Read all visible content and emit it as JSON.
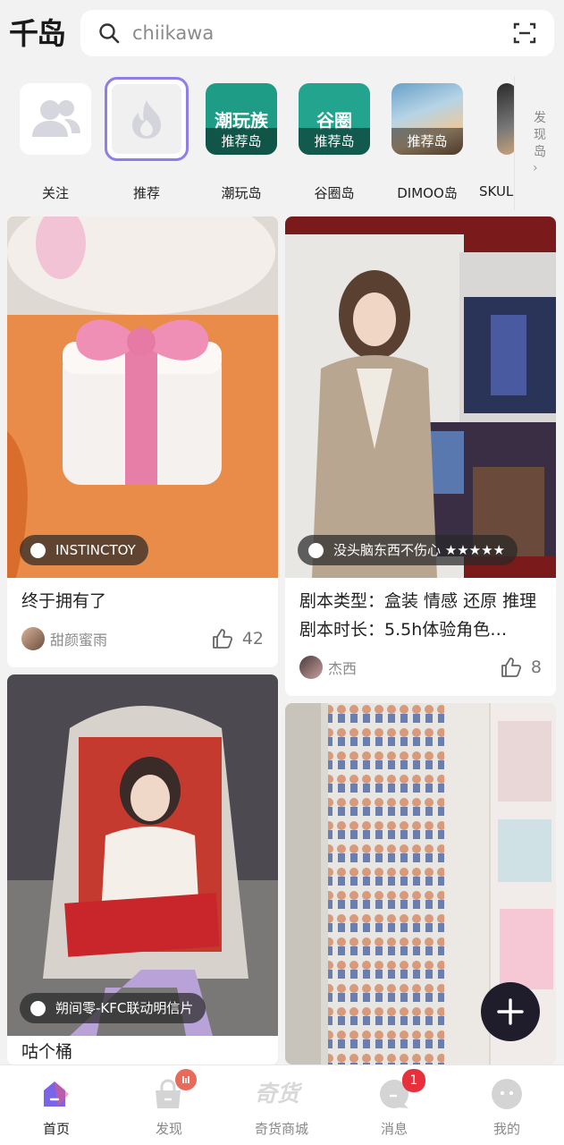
{
  "app": {
    "logo": "千岛"
  },
  "search": {
    "placeholder": "chiikawa"
  },
  "islands": [
    {
      "label": "关注",
      "icon": "people-icon"
    },
    {
      "label": "推荐",
      "icon": "flame-icon",
      "active": true
    },
    {
      "label": "潮玩岛",
      "tile_text": "潮玩族",
      "band": "推荐岛"
    },
    {
      "label": "谷圈岛",
      "tile_text": "谷圈",
      "band": "推荐岛"
    },
    {
      "label": "DIMOO岛",
      "band": "推荐岛"
    },
    {
      "label": "SKUL"
    }
  ],
  "discover_islands": "发现岛",
  "feed": [
    {
      "badge": "INSTINCTOY",
      "title": "终于拥有了",
      "author": "甜颜蜜雨",
      "likes": "42"
    },
    {
      "badge": "没头脑东西不伤心 ★★★★★",
      "title": "剧本类型：盒装 情感 还原 推理剧本时长：5.5h体验角色…",
      "author": "杰西",
      "likes": "8"
    },
    {
      "badge": "朔间零-KFC联动明信片",
      "title": "咕个桶"
    },
    {}
  ],
  "tabs": [
    {
      "label": "首页",
      "icon": "home-icon",
      "active": true
    },
    {
      "label": "发现",
      "icon": "bag-icon",
      "badge": ""
    },
    {
      "label": "奇货商城",
      "icon": "store-icon"
    },
    {
      "label": "消息",
      "icon": "message-icon",
      "badge": "1"
    },
    {
      "label": "我的",
      "icon": "profile-icon"
    }
  ],
  "colors": {
    "accent": "#8e7ee8",
    "fab": "#1f1d2b",
    "badge": "#e8303c",
    "island_green": "#1f9c86"
  }
}
